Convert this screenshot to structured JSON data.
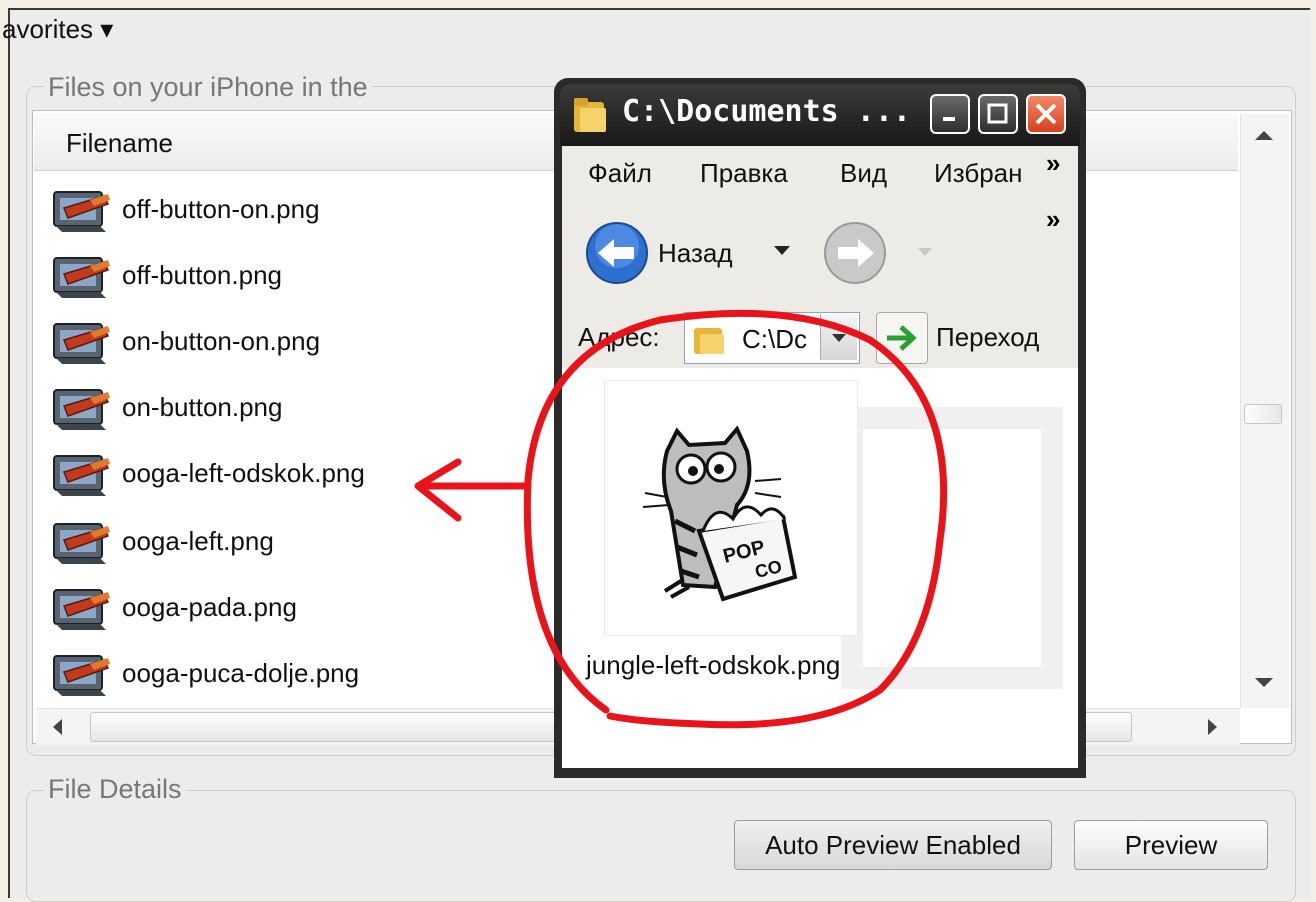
{
  "main": {
    "favorites_label": "avorites ▾",
    "files_group_label": "Files on your iPhone in the",
    "column_filename": "Filename",
    "files": [
      {
        "name": "off-button-on.png"
      },
      {
        "name": "off-button.png"
      },
      {
        "name": "on-button-on.png"
      },
      {
        "name": "on-button.png"
      },
      {
        "name": "ooga-left-odskok.png"
      },
      {
        "name": "ooga-left.png"
      },
      {
        "name": "ooga-pada.png"
      },
      {
        "name": "ooga-puca-dolje.png"
      }
    ],
    "details_group_label": "File Details",
    "auto_preview_label": "Auto Preview Enabled",
    "preview_label": "Preview"
  },
  "explorer": {
    "title": "C:\\Documents ...",
    "menu": [
      "Файл",
      "Правка",
      "Вид",
      "Избран"
    ],
    "menu_more": "»",
    "toolbar_more": "»",
    "back_label": "Назад",
    "address_label": "Адрес:",
    "address_value": "C:\\Dc",
    "go_label": "Переход",
    "file_name": "jungle-left-odskok.png",
    "thumb_text_1": "POP",
    "thumb_text_2": "CO"
  },
  "colors": {
    "annotation": "#e8141a",
    "titlebar": "#1f1f1f",
    "close_button": "#e0532f"
  },
  "icons": [
    "chevron-down-icon",
    "file-icon",
    "folder-icon",
    "back-arrow-icon",
    "forward-arrow-icon",
    "go-arrow-icon",
    "minimize-icon",
    "maximize-icon",
    "close-icon"
  ]
}
